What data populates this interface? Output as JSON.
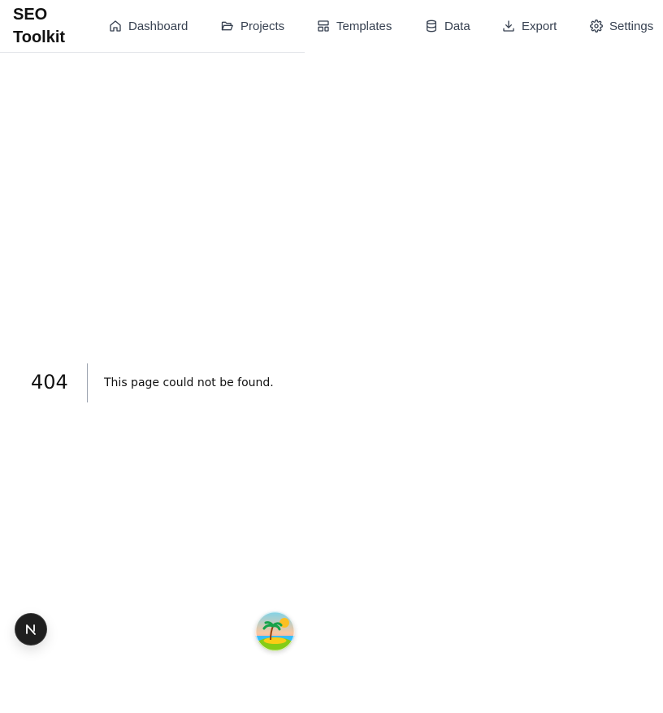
{
  "header": {
    "brand": "SEO Toolkit",
    "nav": [
      {
        "label": "Dashboard",
        "icon": "home-icon"
      },
      {
        "label": "Projects",
        "icon": "folder-open-icon"
      },
      {
        "label": "Templates",
        "icon": "layout-template-icon"
      },
      {
        "label": "Data",
        "icon": "database-icon"
      },
      {
        "label": "Export",
        "icon": "download-icon"
      },
      {
        "label": "Settings",
        "icon": "gear-icon"
      }
    ]
  },
  "error": {
    "code": "404",
    "message": "This page could not be found."
  },
  "floating": {
    "devtools_letter": "N",
    "avatar": "tropical-island-avatar"
  },
  "colors": {
    "text": "#111111",
    "nav_text": "#374151",
    "border": "#e5e7eb",
    "badge_bg": "#1f1f1f"
  }
}
